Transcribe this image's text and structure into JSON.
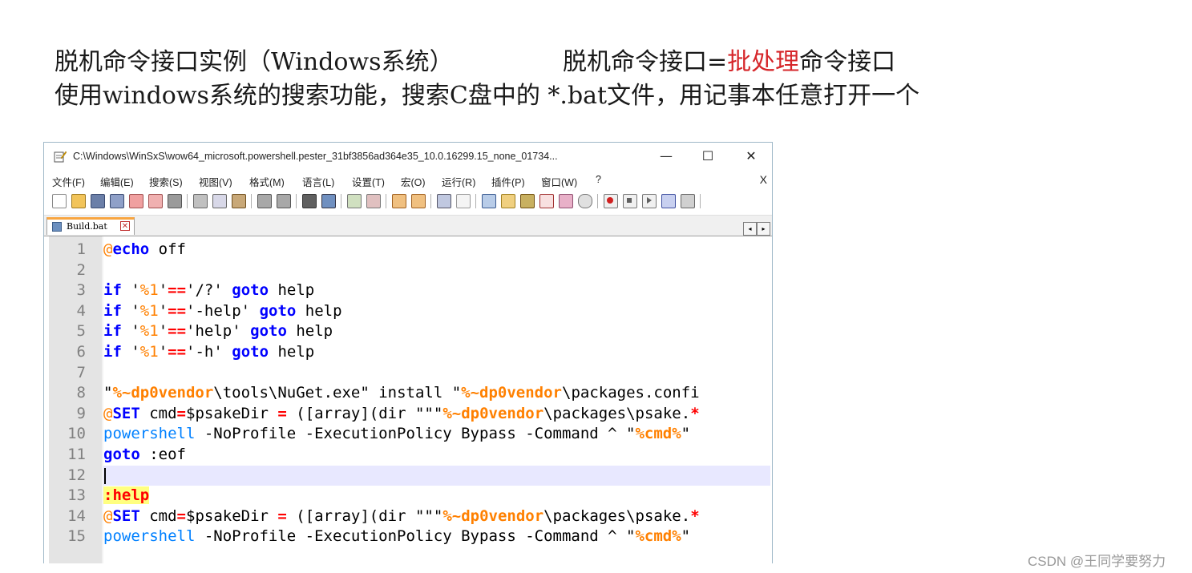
{
  "slide": {
    "heading1_a": "脱机命令接口实例（Windows系统）",
    "heading1_b_pre": "脱机命令接口=",
    "heading1_b_red": "批处理",
    "heading1_b_post": "命令接口",
    "heading2": "使用windows系统的搜索功能，搜索C盘中的 *.bat文件，用记事本任意打开一个",
    "accent_red": "#d6262a"
  },
  "window": {
    "title": "C:\\Windows\\WinSxS\\wow64_microsoft.powershell.pester_31bf3856ad364e35_10.0.16299.15_none_01734...",
    "minimize_glyph": "—",
    "maximize_glyph": "☐",
    "close_glyph": "✕",
    "app_icon": "notepad-plus-icon"
  },
  "menu": {
    "items": [
      "文件(F)",
      "编辑(E)",
      "搜索(S)",
      "视图(V)",
      "格式(M)",
      "语言(L)",
      "设置(T)",
      "宏(O)",
      "运行(R)",
      "插件(P)",
      "窗口(W)",
      "?"
    ],
    "close_glyph": "X"
  },
  "tab": {
    "name": "Build.bat",
    "close_glyph": "✕",
    "accent": "#f8a540"
  },
  "tab_arrows": {
    "left": "◂",
    "right": "▸"
  },
  "editor": {
    "current_line": 12,
    "line_numbers": [
      "1",
      "2",
      "3",
      "4",
      "5",
      "6",
      "7",
      "8",
      "9",
      "10",
      "11",
      "12",
      "13",
      "14",
      "15"
    ]
  },
  "code": {
    "l1_at": "@",
    "l1_kw": "echo",
    "l1_rest": " off",
    "if": "if",
    "goto": "goto",
    "q": "'",
    "v1": "%1",
    "eq": "==",
    "l3_q": "'/?'",
    "l4_q": "'-help'",
    "l5_q": "'help'",
    "l6_q": "'-h'",
    "help": " help",
    "l8_a": "\"",
    "dp0": "%~dp0vendor",
    "l8_b": "\\tools\\NuGet.exe\" install \"",
    "l8_c": "\\packages.confi",
    "set_at": "@",
    "set_kw": "SET",
    "set_a": " cmd",
    "eqsign": "=",
    "set_b": "$psakeDir ",
    "set_c": " ([array](dir \"\"\"",
    "set_d": "\\packages\\psake.",
    "star": "*",
    "ps_kw": "powershell",
    "ps_a": " -NoProfile -ExecutionPolicy Bypass -Command ^ \"",
    "cmdvar": "%cmd%",
    "ps_b": "\"",
    "l11_rest": " :eof",
    "l13_label": ":help"
  },
  "watermark": "CSDN @王同学要努力"
}
